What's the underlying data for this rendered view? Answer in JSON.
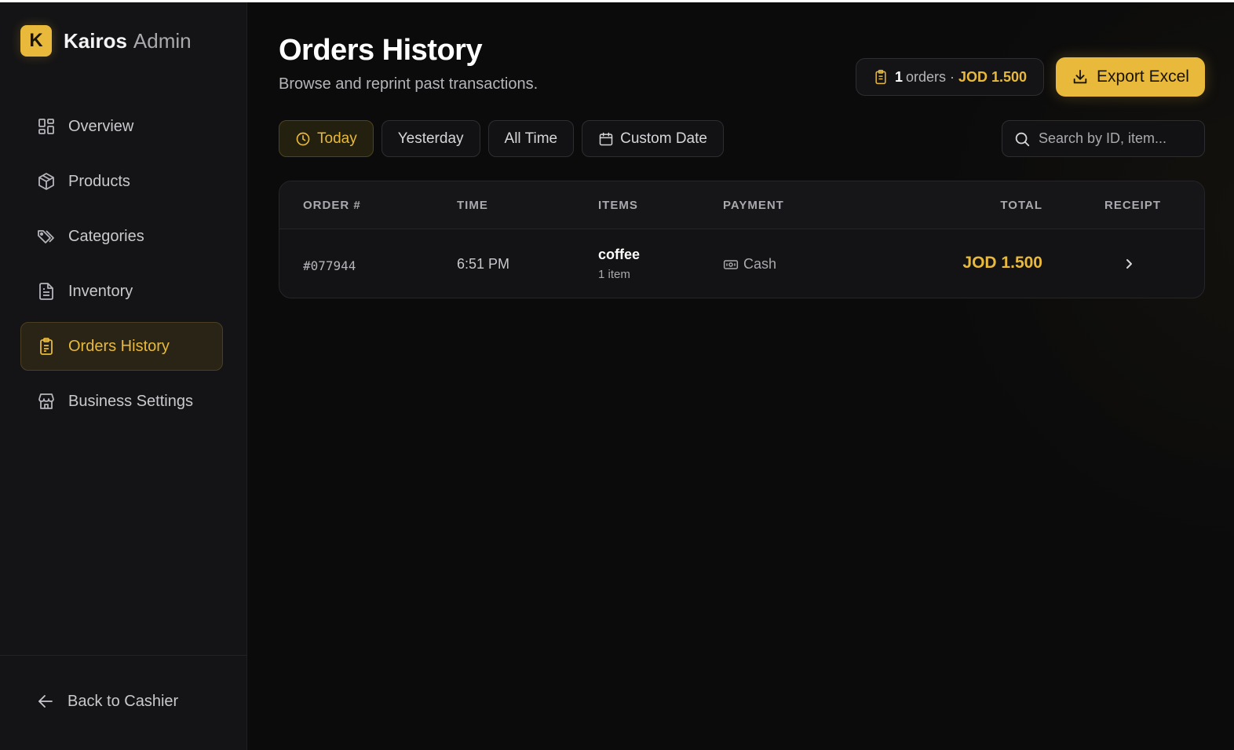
{
  "brand": {
    "logo_letter": "K",
    "name": "Kairos",
    "sub": "Admin"
  },
  "sidebar": {
    "items": [
      {
        "label": "Overview",
        "icon": "grid-icon"
      },
      {
        "label": "Products",
        "icon": "box-icon"
      },
      {
        "label": "Categories",
        "icon": "tags-icon"
      },
      {
        "label": "Inventory",
        "icon": "file-icon"
      },
      {
        "label": "Orders History",
        "icon": "clipboard-icon",
        "active": true
      },
      {
        "label": "Business Settings",
        "icon": "store-icon"
      }
    ],
    "back_label": "Back to Cashier"
  },
  "header": {
    "title": "Orders History",
    "subtitle": "Browse and reprint past transactions."
  },
  "summary": {
    "count": "1",
    "label": "orders",
    "separator": "·",
    "total": "JOD 1.500"
  },
  "export_label": "Export Excel",
  "filters": [
    {
      "label": "Today",
      "active": true,
      "icon": "clock-icon"
    },
    {
      "label": "Yesterday",
      "active": false
    },
    {
      "label": "All Time",
      "active": false
    },
    {
      "label": "Custom Date",
      "active": false,
      "icon": "calendar-icon"
    }
  ],
  "search": {
    "placeholder": "Search by ID, item...",
    "value": ""
  },
  "table": {
    "columns": [
      "ORDER #",
      "TIME",
      "ITEMS",
      "PAYMENT",
      "TOTAL",
      "RECEIPT"
    ],
    "rows": [
      {
        "order_id": "#077944",
        "time": "6:51 PM",
        "item_name": "coffee",
        "item_count": "1 item",
        "payment": "Cash",
        "total": "JOD 1.500"
      }
    ]
  },
  "colors": {
    "accent": "#e8b93a",
    "background": "#0b0b0c",
    "sidebar": "#141416"
  }
}
